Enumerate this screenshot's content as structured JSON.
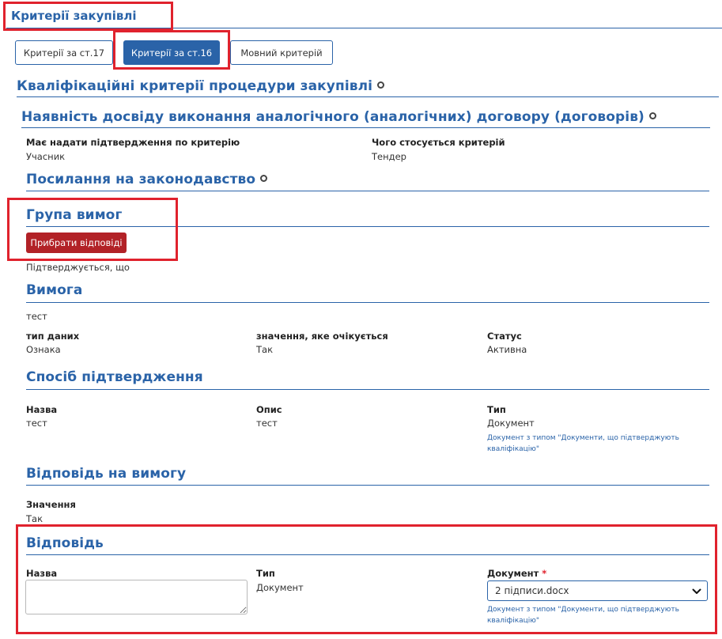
{
  "page": {
    "title": "Критерії закупівлі"
  },
  "tabs": [
    {
      "label": "Критерії за ст.17",
      "active": false
    },
    {
      "label": "Критерії за ст.16",
      "active": true
    },
    {
      "label": "Мовний критерій",
      "active": false
    }
  ],
  "qualification": {
    "heading": "Кваліфікаційні критерії процедури закупівлі"
  },
  "criterion": {
    "heading": "Наявність досвіду виконання аналогічного (аналогічних) договору (договорів)",
    "confirm_label": "Має надати підтвердження по критерію",
    "confirm_value": "Учасник",
    "relates_label": "Чого стосується критерій",
    "relates_value": "Тендер"
  },
  "legislation": {
    "heading": "Посилання на законодавство"
  },
  "group": {
    "heading": "Група вимог",
    "remove_button": "Прибрати відповіді",
    "confirmed_text": "Підтверджується, що"
  },
  "requirement": {
    "heading": "Вимога",
    "text": "тест",
    "datatype_label": "тип даних",
    "datatype_value": "Ознака",
    "expected_label": "значення, яке очікується",
    "expected_value": "Так",
    "status_label": "Статус",
    "status_value": "Активна"
  },
  "evidence": {
    "heading": "Спосіб підтвердження",
    "name_label": "Назва",
    "name_value": "тест",
    "desc_label": "Опис",
    "desc_value": "тест",
    "type_label": "Тип",
    "type_value": "Документ",
    "type_hint": "Документ з типом \"Документи, що підтверджують кваліфікацію\""
  },
  "response": {
    "heading": "Відповідь на вимогу",
    "value_label": "Значення",
    "value_value": "Так"
  },
  "answer": {
    "heading": "Відповідь",
    "name_label": "Назва",
    "name_value": "",
    "type_label": "Тип",
    "type_value": "Документ",
    "doc_label": "Документ",
    "doc_required": "*",
    "doc_selected": "2 підписи.docx",
    "doc_hint": "Документ з типом \"Документи, що підтверджують кваліфікацію\""
  },
  "colors": {
    "accent": "#2a63a8",
    "danger": "#b22227",
    "highlight": "#e0222d"
  },
  "icons": [
    "collapse-dot-icon",
    "chevron-down-icon"
  ]
}
